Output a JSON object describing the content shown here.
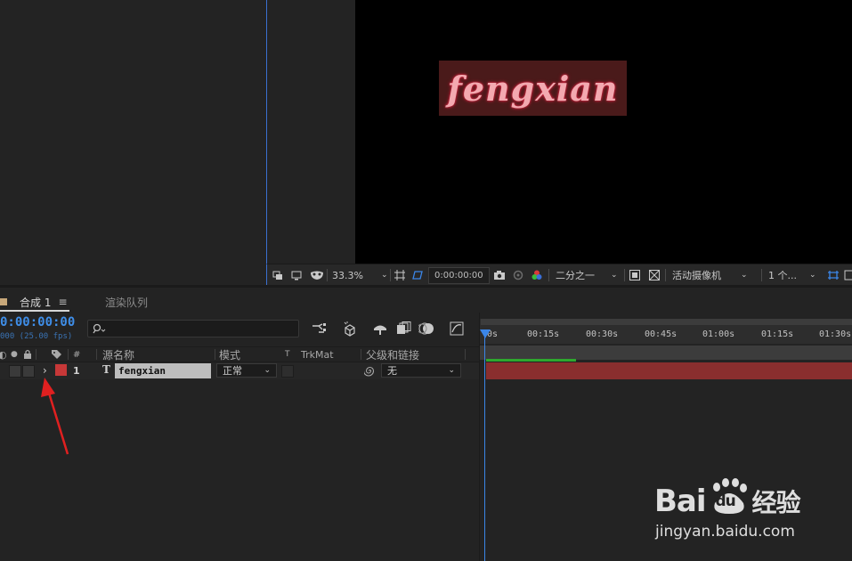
{
  "viewer": {
    "preview_text": "fengxian",
    "toolbar": {
      "zoom": "33.3%",
      "timecode": "0:00:00:00",
      "resolution": "二分之一",
      "camera": "活动摄像机",
      "views": "1 个..."
    }
  },
  "tabs": {
    "comp_label": "合成 1",
    "render_queue_label": "渲染队列"
  },
  "timeline": {
    "current_time": "0:00:00:00",
    "fps": "000 (25.00 fps)",
    "ticks": [
      "0s",
      "00:15s",
      "00:30s",
      "00:45s",
      "01:00s",
      "01:15s",
      "01:30s"
    ]
  },
  "columns": {
    "number": "#",
    "source_name": "源名称",
    "mode": "模式",
    "t": "T",
    "trkmat": "TrkMat",
    "parent": "父级和链接"
  },
  "layer": {
    "number": "1",
    "type": "T",
    "name": "fengxian",
    "mode": "正常",
    "parent": "无",
    "label_color": "#c73838"
  },
  "watermark": {
    "brand": "Bai",
    "brand_du": "du",
    "brand_cn": "经验",
    "url": "jingyan.baidu.com"
  },
  "colors": {
    "accent_blue": "#3b86e8",
    "annotation_red": "#e02020"
  }
}
